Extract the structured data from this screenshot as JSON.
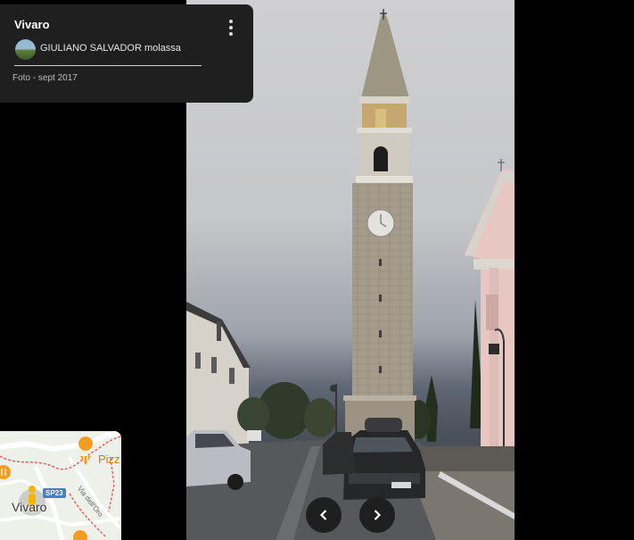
{
  "place": {
    "title": "Vivaro"
  },
  "author": {
    "name": "GIULIANO SALVADOR molassa"
  },
  "photo": {
    "date": "Foto - sept 2017"
  },
  "map": {
    "town_label": "Vivaro",
    "poi_label": "Pizz",
    "road_badge": "SP23",
    "street_label": "Via dell'Oro"
  },
  "icons": {
    "more": "more-vert-icon",
    "prev": "chevron-left-icon",
    "next": "chevron-right-icon",
    "pegman": "pegman-icon",
    "restaurant": "restaurant-pin-icon"
  },
  "colors": {
    "card_bg": "#1f1f1f",
    "nav_bg": "#1f1f1f",
    "map_road_badge": "#4b7ec2",
    "poi_orange": "#f29d1f",
    "pegman_yellow": "#f5b400"
  }
}
